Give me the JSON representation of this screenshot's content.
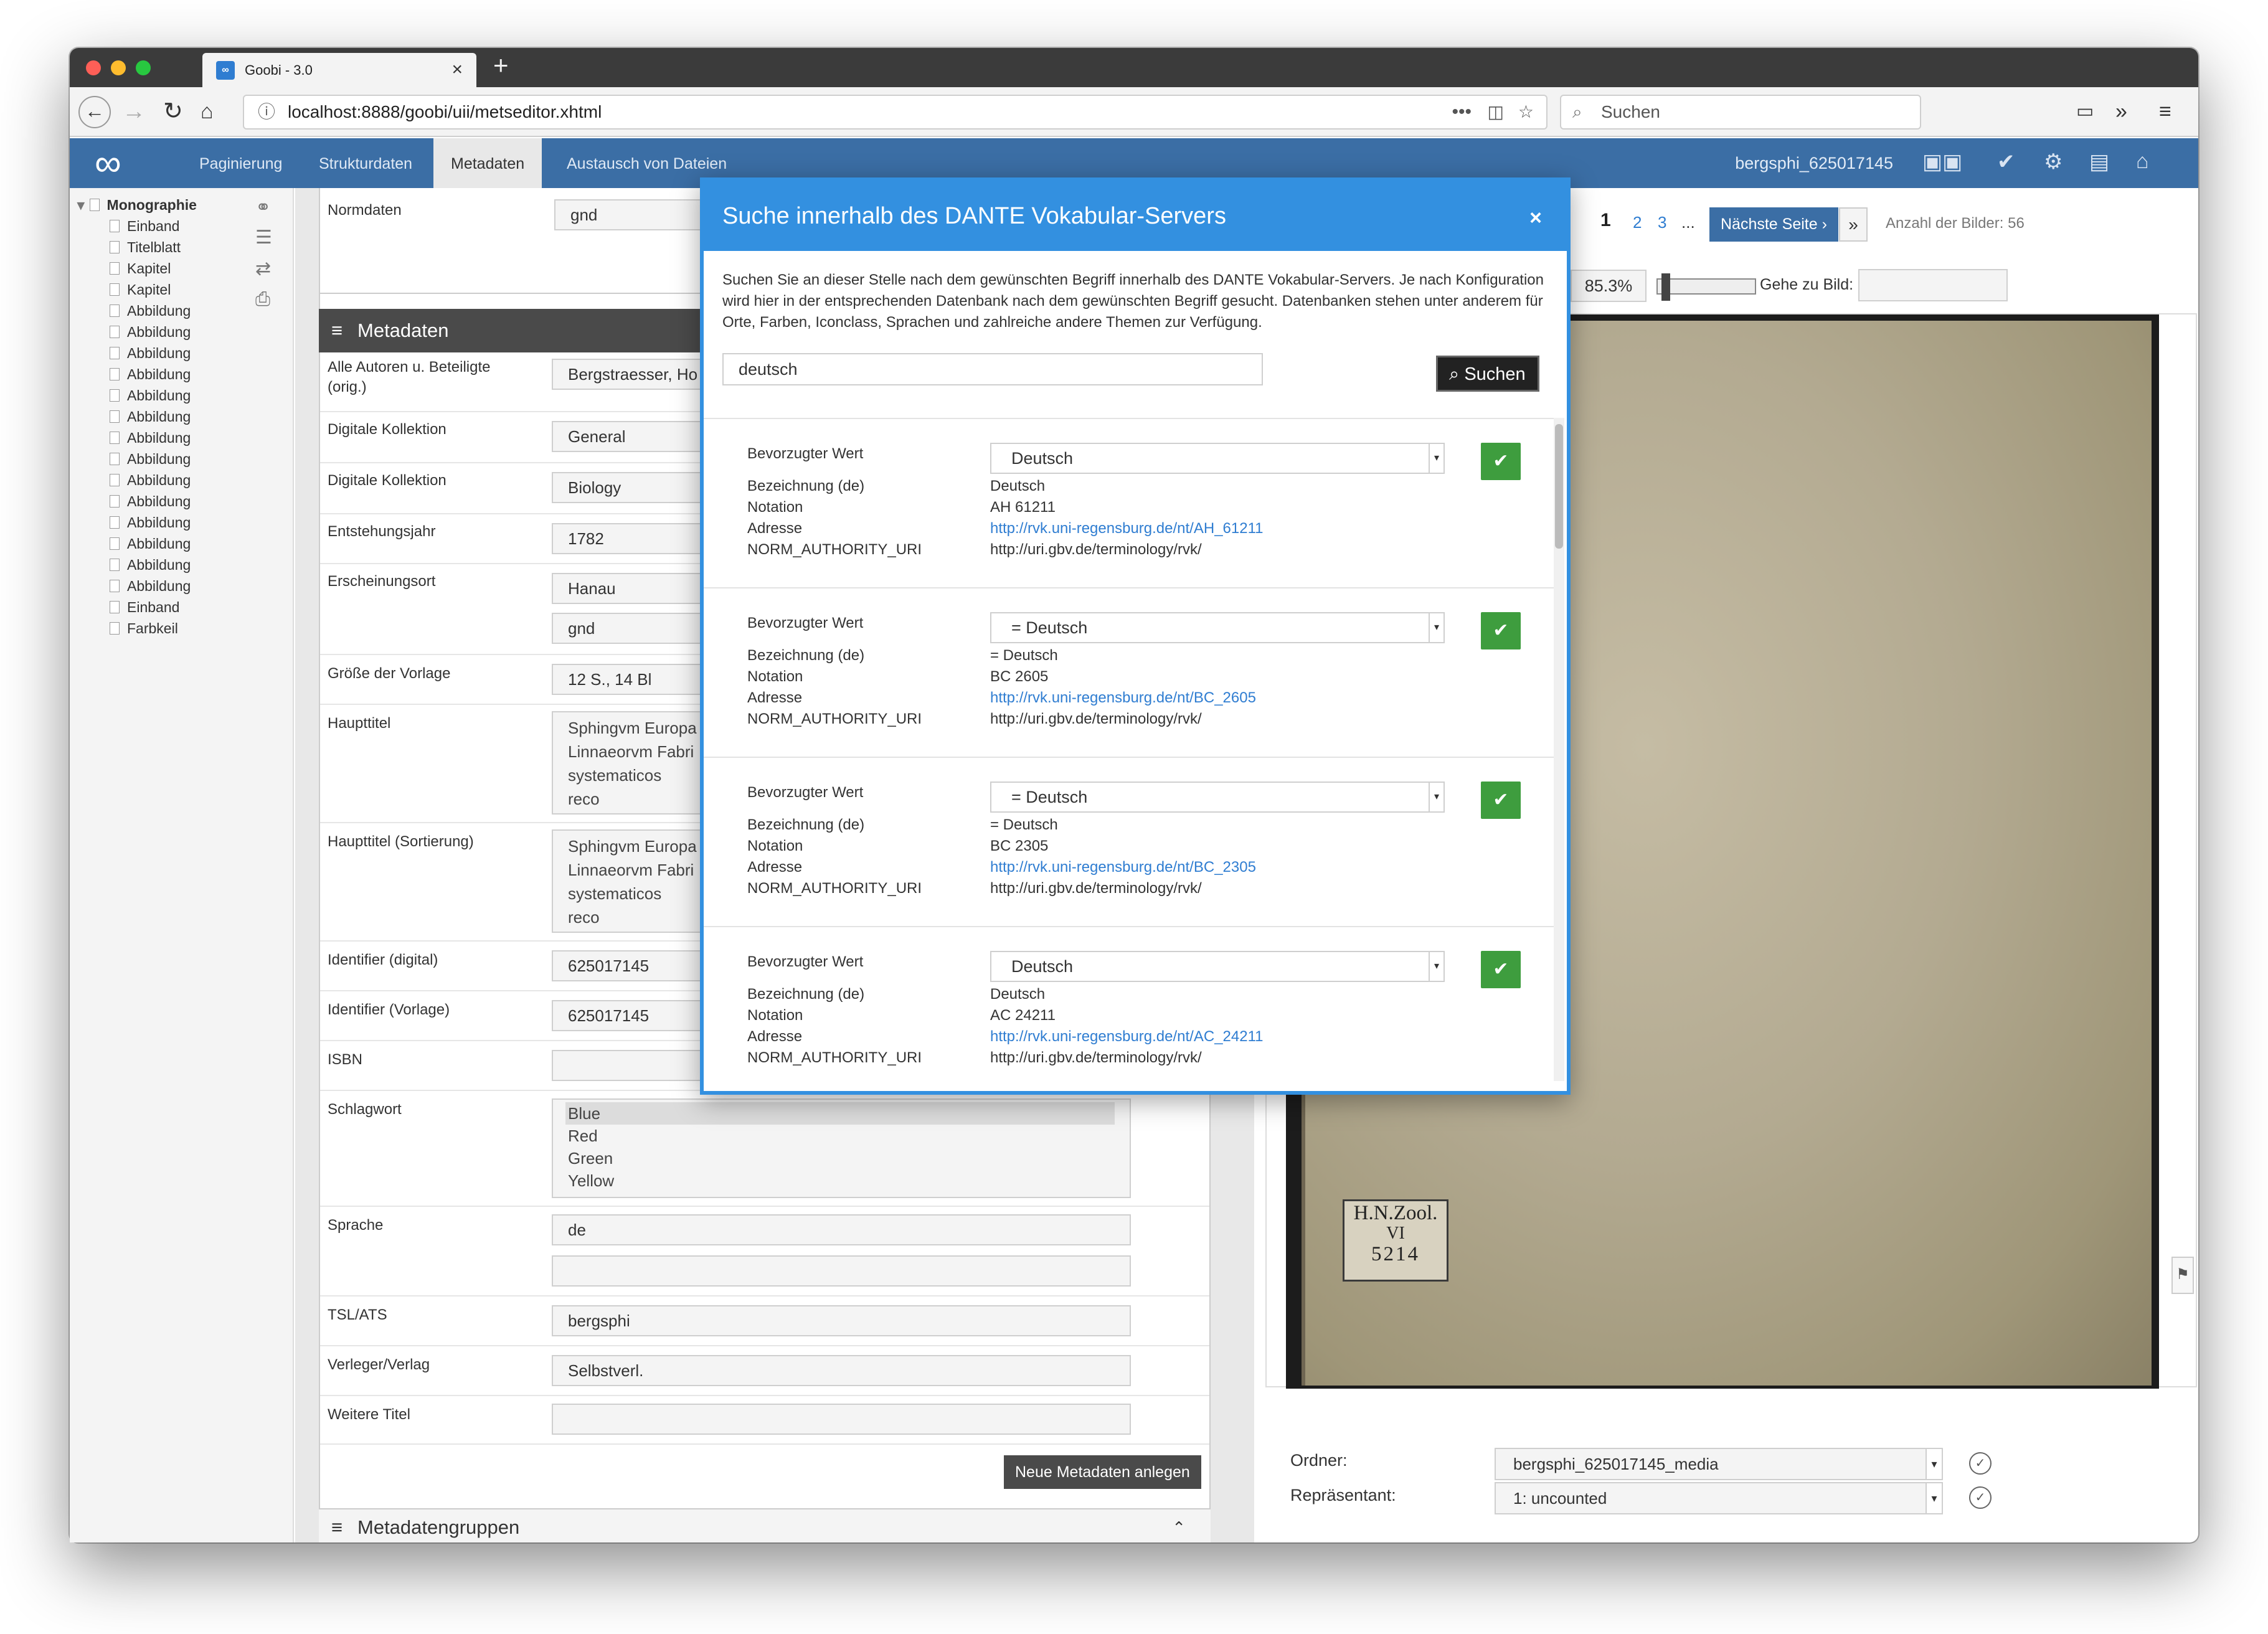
{
  "browser": {
    "tab_title": "Goobi - 3.0",
    "favicon_text": "∞",
    "url": "localhost:8888/goobi/uii/metseditor.xhtml",
    "search_placeholder": "Suchen"
  },
  "app": {
    "nav": [
      "Paginierung",
      "Strukturdaten",
      "Metadaten",
      "Austausch von Dateien"
    ],
    "active_nav": "Metadaten",
    "record_id": "bergsphi_625017145",
    "accent": "#3b6ea5"
  },
  "tree": {
    "root": "Monographie",
    "items": [
      "Einband",
      "Titelblatt",
      "Kapitel",
      "Kapitel",
      "Abbildung",
      "Abbildung",
      "Abbildung",
      "Abbildung",
      "Abbildung",
      "Abbildung",
      "Abbildung",
      "Abbildung",
      "Abbildung",
      "Abbildung",
      "Abbildung",
      "Abbildung",
      "Abbildung",
      "Abbildung",
      "Einband",
      "Farbkeil"
    ]
  },
  "metadata": {
    "normdaten_label": "Normdaten",
    "normdaten_value": "gnd",
    "section_title": "Metadaten",
    "fields": {
      "autoren_label": "Alle Autoren u. Beteiligte (orig.)",
      "autoren_value": "Bergstraesser, Ho",
      "koll1_label": "Digitale Kollektion",
      "koll1_value": "General",
      "koll2_label": "Digitale Kollektion",
      "koll2_value": "Biology",
      "jahr_label": "Entstehungsjahr",
      "jahr_value": "1782",
      "ort_label": "Erscheinungsort",
      "ort_value": "Hanau",
      "ort_norm": "gnd",
      "groesse_label": "Größe der Vorlage",
      "groesse_value": "12 S., 14 Bl",
      "haupttitel_label": "Haupttitel",
      "haupttitel_value": "Sphingvm Europa Linnaeorvm Fabri systematicos reco evropaeischen Sc",
      "haupttitel_sort_label": "Haupttitel (Sortierung)",
      "haupttitel_sort_value": "Sphingvm Europa Linnaeorvm Fabri systematicos reco evropaeischen Sc",
      "id_digital_label": "Identifier (digital)",
      "id_digital_value": "625017145",
      "id_vorlage_label": "Identifier (Vorlage)",
      "id_vorlage_value": "625017145",
      "isbn_label": "ISBN",
      "isbn_value": "",
      "schlagwort_label": "Schlagwort",
      "schlagwort_options": [
        "Blue",
        "Red",
        "Green",
        "Yellow"
      ],
      "sprache_label": "Sprache",
      "sprache_value": "de",
      "tsl_label": "TSL/ATS",
      "tsl_value": "bergsphi",
      "verleger_label": "Verleger/Verlag",
      "verleger_value": "Selbstverl.",
      "weitere_label": "Weitere Titel",
      "weitere_value": ""
    },
    "new_button": "Neue Metadaten anlegen",
    "groups_title": "Metadatengruppen"
  },
  "image_panel": {
    "pages": [
      "1",
      "2",
      "3",
      "..."
    ],
    "next_page": "Nächste Seite ›",
    "last": "»",
    "image_count": "Anzahl der Bilder: 56",
    "zoom": "85.3%",
    "goto_label": "Gehe zu Bild:",
    "stamp_line1": "H.N.Zool.",
    "stamp_line2": "VI",
    "stamp_line3": "5214",
    "ordner_label": "Ordner:",
    "ordner_value": "bergsphi_625017145_media",
    "repraesentant_label": "Repräsentant:",
    "repraesentant_value": "1: uncounted"
  },
  "modal": {
    "title": "Suche innerhalb des DANTE Vokabular-Servers",
    "close": "×",
    "description": "Suchen Sie an dieser Stelle nach dem gewünschten Begriff innerhalb des DANTE Vokabular-Servers. Je nach Konfiguration wird hier in der entsprechenden Datenbank nach dem gewünschten Begriff gesucht. Datenbanken stehen unter anderem für Orte, Farben, Iconclass, Sprachen und zahlreiche andere Themen zur Verfügung.",
    "query": "deutsch",
    "search_button": "Suchen",
    "labels": {
      "preferred": "Bevorzugter Wert",
      "bezeichnung": "Bezeichnung (de)",
      "notation": "Notation",
      "adresse": "Adresse",
      "uri": "NORM_AUTHORITY_URI"
    },
    "results": [
      {
        "preferred": "Deutsch",
        "bezeichnung": "Deutsch",
        "notation": "AH 61211",
        "adresse": "http://rvk.uni-regensburg.de/nt/AH_61211",
        "uri": "http://uri.gbv.de/terminology/rvk/"
      },
      {
        "preferred": "= Deutsch",
        "bezeichnung": "= Deutsch",
        "notation": "BC 2605",
        "adresse": "http://rvk.uni-regensburg.de/nt/BC_2605",
        "uri": "http://uri.gbv.de/terminology/rvk/"
      },
      {
        "preferred": "= Deutsch",
        "bezeichnung": "= Deutsch",
        "notation": "BC 2305",
        "adresse": "http://rvk.uni-regensburg.de/nt/BC_2305",
        "uri": "http://uri.gbv.de/terminology/rvk/"
      },
      {
        "preferred": "Deutsch",
        "bezeichnung": "Deutsch",
        "notation": "AC 24211",
        "adresse": "http://rvk.uni-regensburg.de/nt/AC_24211",
        "uri": "http://uri.gbv.de/terminology/rvk/"
      }
    ],
    "accent": "#3390e0",
    "ok_color": "#3e9d3e"
  }
}
